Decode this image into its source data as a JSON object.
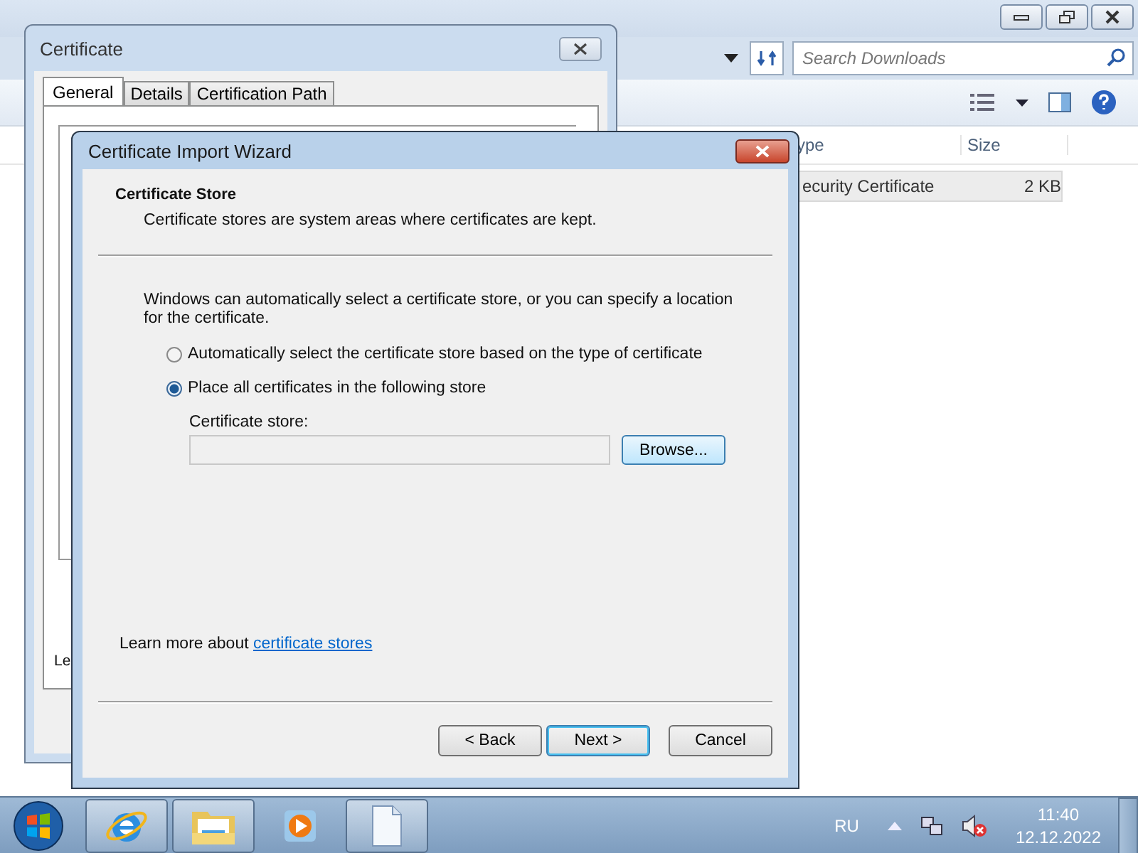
{
  "explorer": {
    "search": {
      "placeholder": "Search Downloads"
    },
    "columns": [
      "ype",
      "Size"
    ],
    "rows": [
      {
        "cells": [
          "ecurity Certificate",
          "2 KB"
        ],
        "selected": true
      }
    ]
  },
  "certificate_dialog": {
    "title": "Certificate",
    "tabs": [
      {
        "label": "General",
        "selected": true
      },
      {
        "label": "Details",
        "selected": false
      },
      {
        "label": "Certification Path",
        "selected": false
      }
    ],
    "visible_text": "Le"
  },
  "wizard": {
    "title": "Certificate Import Wizard",
    "heading": "Certificate Store",
    "subheading": "Certificate stores are system areas where certificates are kept.",
    "intro": "Windows can automatically select a certificate store, or you can specify a location for the certificate.",
    "options": [
      {
        "label": "Automatically select the certificate store based on the type of certificate",
        "selected": false
      },
      {
        "label": "Place all certificates in the following store",
        "selected": true
      }
    ],
    "store_label": "Certificate store:",
    "browse": "Browse...",
    "learn_more": {
      "text": "Learn more about",
      "link": "certificate stores"
    },
    "buttons": [
      {
        "label": "< Back",
        "default": false
      },
      {
        "label": "Next >",
        "default": true
      },
      {
        "label": "Cancel",
        "default": false
      }
    ]
  },
  "taskbar": {
    "apps": [
      {
        "kind": "browser",
        "running": true
      },
      {
        "kind": "folder",
        "running": true
      },
      {
        "kind": "media",
        "running": false
      },
      {
        "kind": "document",
        "running": true
      }
    ],
    "language": "RU",
    "time": "11:40",
    "date": "12.12.2022"
  }
}
